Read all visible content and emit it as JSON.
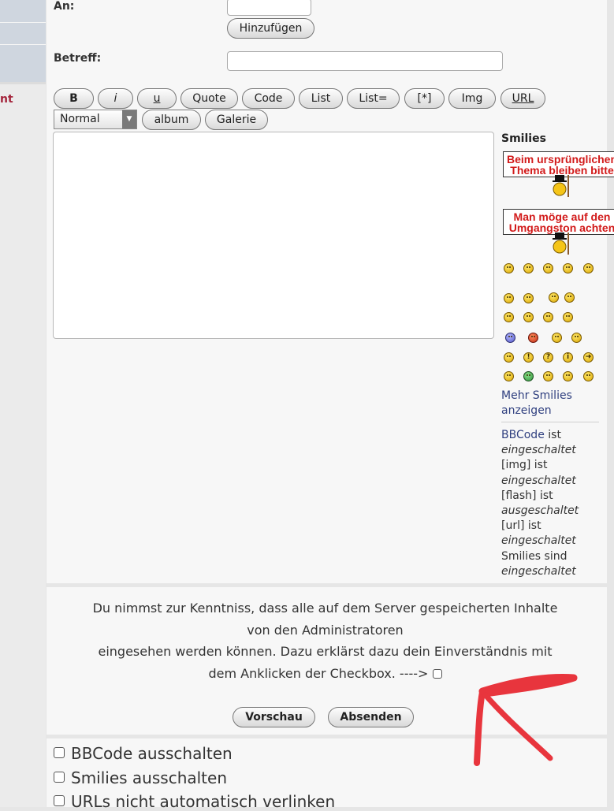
{
  "sidebar": {
    "fragment": "nt"
  },
  "form": {
    "to_label": "An:",
    "to_value": "",
    "add_button": "Hinzufügen",
    "subject_label": "Betreff:",
    "subject_value": ""
  },
  "toolbar": {
    "bold": "B",
    "italic": "i",
    "underline": "u",
    "quote": "Quote",
    "code": "Code",
    "list": "List",
    "list_eq": "List=",
    "list_item": "[*]",
    "img": "Img",
    "url": "URL",
    "size_select": "Normal",
    "album": "album",
    "galerie": "Galerie"
  },
  "smilies": {
    "heading": "Smilies",
    "banner1": [
      "Beim ursprünglichen",
      "Thema bleiben bitte"
    ],
    "banner2": [
      "Man möge auf den",
      "Umgangston achten"
    ],
    "more": "Mehr Smilies anzeigen"
  },
  "status": [
    {
      "name": "BBCode",
      "verb": " ist",
      "state": "eingeschaltet",
      "link": true
    },
    {
      "name": "[img]",
      "verb": " ist",
      "state": "eingeschaltet",
      "link": false
    },
    {
      "name": "[flash]",
      "verb": " ist",
      "state": "ausgeschaltet",
      "link": false
    },
    {
      "name": "[url]",
      "verb": " ist",
      "state": "eingeschaltet",
      "link": false
    },
    {
      "name": "Smilies",
      "verb": " sind",
      "state": "eingeschaltet",
      "link": false
    }
  ],
  "notice": {
    "line1": "Du nimmst zur Kenntniss, dass alle auf dem Server gespeicherten Inhalte",
    "line2": "von den Administratoren",
    "line3": "eingesehen werden können. Dazu erklärst dazu dein Einverständnis mit",
    "line4": "dem Anklicken der Checkbox. ---->"
  },
  "actions": {
    "preview": "Vorschau",
    "submit": "Absenden"
  },
  "options": {
    "bbcode_off": "BBCode ausschalten",
    "smilies_off": "Smilies ausschalten",
    "urls_off": "URLs nicht automatisch verlinken"
  },
  "colors": {
    "annotation": "#e8353d",
    "link": "#2f3f7f",
    "banner_text": "#d21a1a"
  }
}
